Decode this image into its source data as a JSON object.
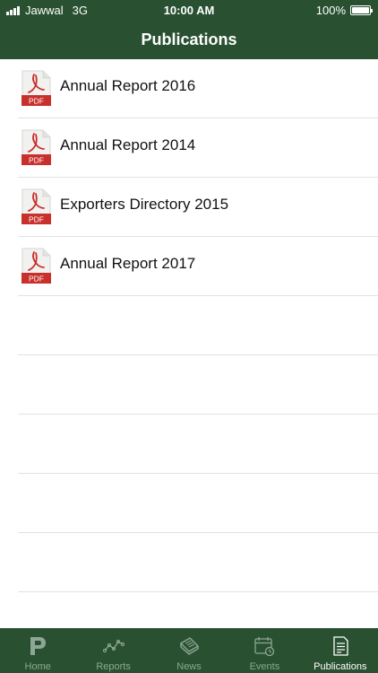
{
  "status_bar": {
    "carrier": "Jawwal",
    "network": "3G",
    "time": "10:00 AM",
    "battery": "100%",
    "battery_level": 1.0
  },
  "nav": {
    "title": "Publications"
  },
  "publications": [
    {
      "title": "Annual Report 2016",
      "icon": "pdf-file-icon",
      "badge": "PDF"
    },
    {
      "title": "Annual Report 2014",
      "icon": "pdf-file-icon",
      "badge": "PDF"
    },
    {
      "title": "Exporters Directory 2015",
      "icon": "pdf-file-icon",
      "badge": "PDF"
    },
    {
      "title": "Annual Report 2017",
      "icon": "pdf-file-icon",
      "badge": "PDF"
    }
  ],
  "tabs": [
    {
      "label": "Home",
      "icon": "home-logo-icon",
      "active": false
    },
    {
      "label": "Reports",
      "icon": "line-chart-icon",
      "active": false
    },
    {
      "label": "News",
      "icon": "newspaper-icon",
      "active": false
    },
    {
      "label": "Events",
      "icon": "calendar-clock-icon",
      "active": false
    },
    {
      "label": "Publications",
      "icon": "document-list-icon",
      "active": true
    }
  ],
  "colors": {
    "brand_green": "#295131",
    "pdf_red": "#c8302c",
    "tab_inactive": "#8ea694",
    "tab_active": "#ffffff"
  }
}
